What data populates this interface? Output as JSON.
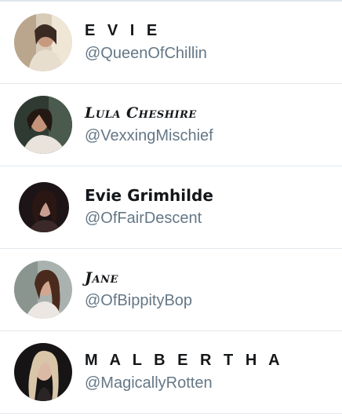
{
  "users": [
    {
      "display_name": "E V I E",
      "handle": "@QueenOfChillin"
    },
    {
      "display_name": "Lula Cheshire",
      "handle": "@VexxingMischief"
    },
    {
      "display_name": "Evie Grimhilde",
      "handle": "@OfFairDescent"
    },
    {
      "display_name": "Jane",
      "handle": "@OfBippityBop"
    },
    {
      "display_name": "M A L B E R T H A",
      "handle": "@MagicallyRotten"
    }
  ]
}
